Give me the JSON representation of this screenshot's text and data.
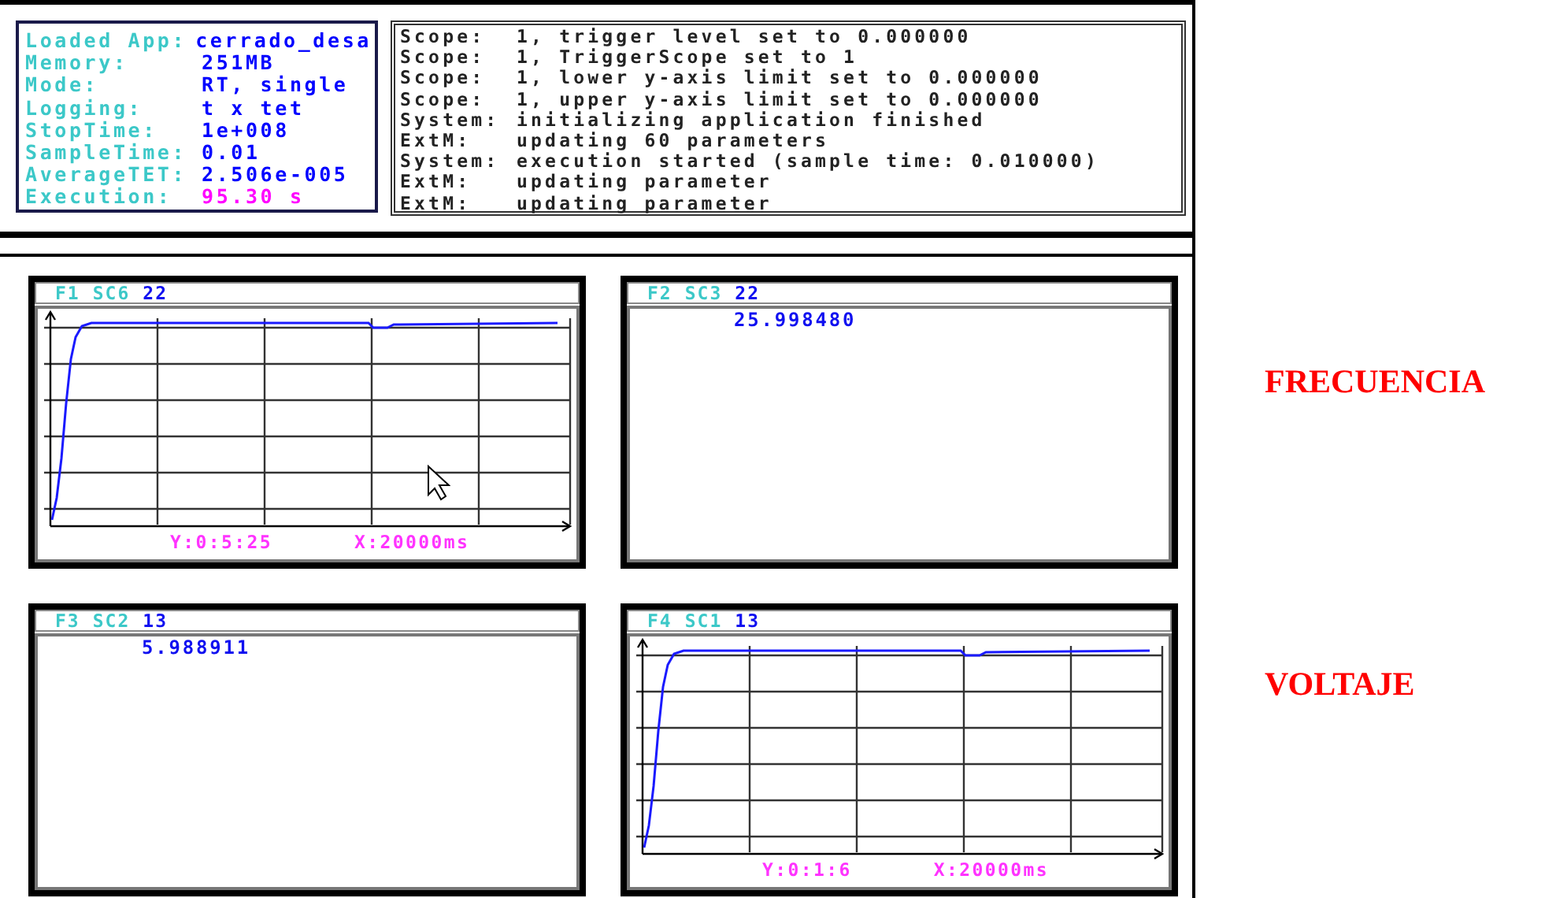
{
  "info": [
    {
      "label": "Loaded App:",
      "value": "cerrado_desa",
      "color": "#0000ff"
    },
    {
      "label": "Memory:",
      "value": "251MB",
      "color": "#0000ff"
    },
    {
      "label": "Mode:",
      "value": "RT, single",
      "color": "#0000ff"
    },
    {
      "label": "Logging:",
      "value": "t x tet",
      "color": "#0000ff"
    },
    {
      "label": "StopTime:",
      "value": "1e+008",
      "color": "#0000ff"
    },
    {
      "label": "SampleTime:",
      "value": "0.01",
      "color": "#0000ff"
    },
    {
      "label": "AverageTET:",
      "value": "2.506e-005",
      "color": "#0000ff"
    },
    {
      "label": "Execution:",
      "value": "95.30 s",
      "color": "#ff00ff"
    }
  ],
  "log": [
    {
      "source": "Scope:",
      "message": "1, trigger level set to 0.000000"
    },
    {
      "source": "Scope:",
      "message": "1, TriggerScope set to 1"
    },
    {
      "source": "Scope:",
      "message": "1, lower y-axis limit set to 0.000000"
    },
    {
      "source": "Scope:",
      "message": "1, upper y-axis limit set to 0.000000"
    },
    {
      "source": "System:",
      "message": "initializing application finished"
    },
    {
      "source": "ExtM:",
      "message": "updating 60 parameters"
    },
    {
      "source": "System:",
      "message": "execution started (sample time: 0.010000)"
    },
    {
      "source": "ExtM:",
      "message": "updating parameter"
    },
    {
      "source": "ExtM:",
      "message": "updating parameter"
    }
  ],
  "scopes": [
    {
      "figure": "F1",
      "scope": "SC6",
      "number": "22",
      "kind": "graph",
      "y_readout": "Y:0:5:25",
      "x_readout": "X:20000ms",
      "cursor": true
    },
    {
      "figure": "F2",
      "scope": "SC3",
      "number": "22",
      "kind": "numeric",
      "value": "25.998480",
      "cursor": false
    },
    {
      "figure": "F3",
      "scope": "SC2",
      "number": "13",
      "kind": "numeric",
      "value": "5.988911",
      "cursor": false
    },
    {
      "figure": "F4",
      "scope": "SC1",
      "number": "13",
      "kind": "graph",
      "y_readout": "Y:0:1:6",
      "x_readout": "X:20000ms",
      "cursor": false
    }
  ],
  "labels": [
    "FRECUENCIA",
    "VOLTAJE"
  ]
}
